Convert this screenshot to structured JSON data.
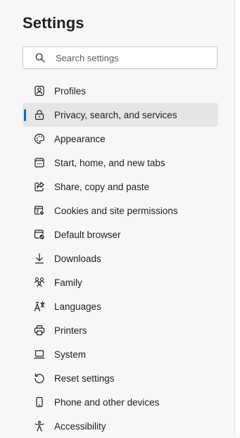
{
  "header": {
    "title": "Settings"
  },
  "search": {
    "icon": "search-icon",
    "placeholder": "Search settings",
    "value": ""
  },
  "sidebar": {
    "accent_color": "#0f6cbd",
    "active_index": 1,
    "items": [
      {
        "label": "Profiles",
        "icon": "profile-icon"
      },
      {
        "label": "Privacy, search, and services",
        "icon": "lock-icon"
      },
      {
        "label": "Appearance",
        "icon": "palette-icon"
      },
      {
        "label": "Start, home, and new tabs",
        "icon": "window-icon"
      },
      {
        "label": "Share, copy and paste",
        "icon": "share-icon"
      },
      {
        "label": "Cookies and site permissions",
        "icon": "cookies-permissions-icon"
      },
      {
        "label": "Default browser",
        "icon": "default-browser-icon"
      },
      {
        "label": "Downloads",
        "icon": "download-icon"
      },
      {
        "label": "Family",
        "icon": "family-icon"
      },
      {
        "label": "Languages",
        "icon": "languages-icon"
      },
      {
        "label": "Printers",
        "icon": "printer-icon"
      },
      {
        "label": "System",
        "icon": "laptop-icon"
      },
      {
        "label": "Reset settings",
        "icon": "reset-icon"
      },
      {
        "label": "Phone and other devices",
        "icon": "phone-icon"
      },
      {
        "label": "Accessibility",
        "icon": "accessibility-icon"
      }
    ]
  }
}
